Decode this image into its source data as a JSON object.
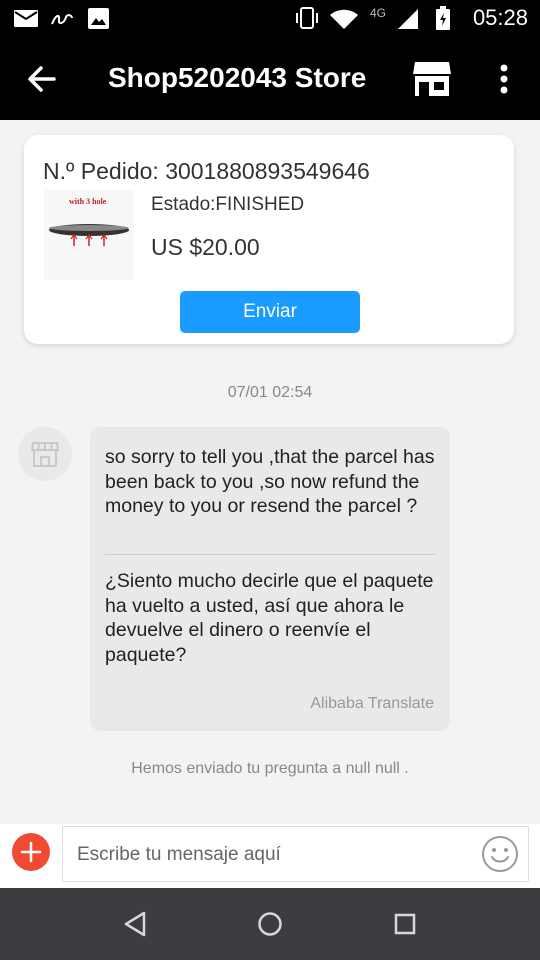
{
  "status_bar": {
    "time": "05:28",
    "network": "4G",
    "icons": [
      "mail-icon",
      "app-logo-icon",
      "image-icon",
      "vibrate-icon",
      "wifi-icon",
      "signal-icon",
      "battery-icon"
    ]
  },
  "toolbar": {
    "title": "Shop5202043 Store",
    "icons": [
      "back-arrow-icon",
      "store-icon",
      "more-vert-icon"
    ]
  },
  "order": {
    "number_label": "N.º Pedido: 3001880893549646",
    "thumbnail_caption": "with 3 hole",
    "status": "Estado:FINISHED",
    "price": "US $20.00",
    "send_label": "Enviar",
    "accent_color": "#1a9bff"
  },
  "chat": {
    "timestamp": "07/01 02:54",
    "message_original": "so sorry to tell you ,that the parcel has been back to you ,so now refund the money to you or resend the parcel ?",
    "message_translated": "¿Siento mucho decirle que el paquete ha vuelto a usted, así que ahora le devuelve el dinero o reenvíe el paquete?",
    "translator_note": "Alibaba Translate",
    "system_note": "Hemos enviado tu pregunta a null null ."
  },
  "composer": {
    "placeholder": "Escribe tu mensaje aquí",
    "value": "",
    "plus_color": "#f04a33"
  },
  "nav_bar": {
    "buttons": [
      "back-triangle-icon",
      "home-circle-icon",
      "recents-square-icon"
    ]
  }
}
